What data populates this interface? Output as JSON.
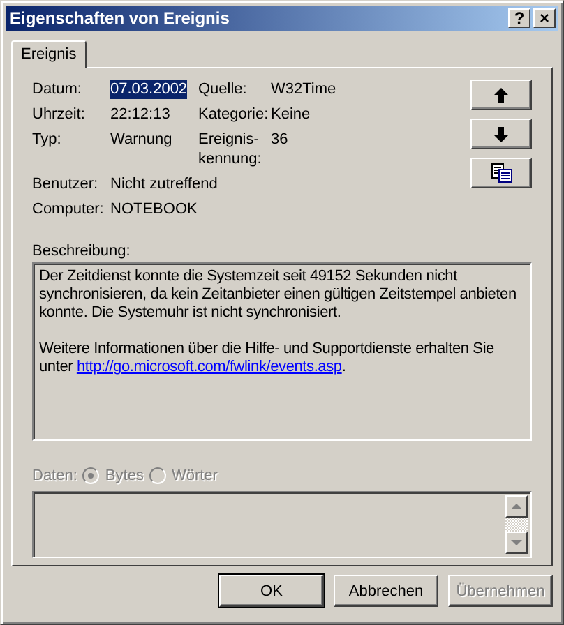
{
  "window": {
    "title": "Eigenschaften von Ereignis",
    "controls": [
      "?",
      "×"
    ]
  },
  "tabs": [
    {
      "label": "Ereignis",
      "selected": true
    }
  ],
  "fields": [
    [
      {
        "label": "Datum:",
        "value": "07.03.2002",
        "selected": true
      },
      {
        "label": "Quelle:",
        "value": "W32Time",
        "selected": false
      }
    ],
    [
      {
        "label": "Uhrzeit:",
        "value": "22:12:13",
        "selected": false
      },
      {
        "label": "Kategorie:",
        "value": "Keine",
        "selected": false
      }
    ],
    [
      {
        "label": "Typ:",
        "value": "Warnung",
        "selected": false
      },
      {
        "label": "Ereignis-kennung:",
        "value": "36",
        "selected": false
      }
    ],
    [
      {
        "label": "Benutzer:",
        "value": "Nicht zutreffend",
        "selected": false
      }
    ],
    [
      {
        "label": "Computer:",
        "value": "NOTEBOOK",
        "selected": false
      }
    ]
  ],
  "side_buttons": [
    {
      "kind": "up"
    },
    {
      "kind": "down"
    },
    {
      "kind": "copy"
    }
  ],
  "description": {
    "label": "Beschreibung:",
    "paragraphs": [
      {
        "text": "Der Zeitdienst konnte die Systemzeit seit 49152 Sekunden nicht synchronisieren, da kein Zeitanbieter einen gültigen Zeitstempel anbieten konnte. Die Systemuhr ist nicht synchronisiert."
      },
      {
        "text": "Weitere Informationen über die Hilfe- und Supportdienste erhalten Sie unter ",
        "link": "http://go.microsoft.com/fwlink/events.asp",
        "after": "."
      }
    ]
  },
  "data": {
    "label": "Daten:",
    "disabled": true,
    "options": [
      {
        "label": "Bytes",
        "selected": true
      },
      {
        "label": "Wörter",
        "selected": false
      }
    ]
  },
  "buttons": [
    {
      "label": "OK",
      "default": true,
      "disabled": false
    },
    {
      "label": "Abbrechen",
      "default": false,
      "disabled": false
    },
    {
      "label": "Übernehmen",
      "default": false,
      "disabled": true
    }
  ]
}
